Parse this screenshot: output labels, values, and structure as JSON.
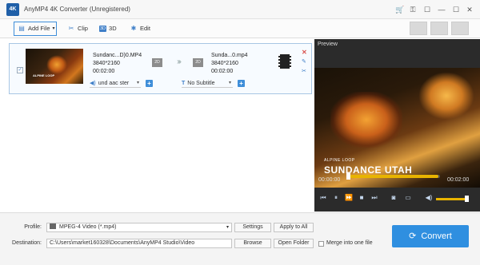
{
  "app": {
    "logo_text": "4K",
    "title": "AnyMP4 4K Converter (Unregistered)"
  },
  "window_controls": {
    "cart": "🛒",
    "key": "⚿",
    "feedback": "☐",
    "minimize": "—",
    "maximize": "☐",
    "close": "✕"
  },
  "toolbar": {
    "add_file": "Add File",
    "clip": "Clip",
    "three_d": "3D",
    "three_d_badge": "3D",
    "edit": "Edit",
    "output_buttons": [
      "",
      "",
      ""
    ]
  },
  "file": {
    "checked": true,
    "check_mark": "✓",
    "thumb_label": "ALPINE LOOP",
    "source": {
      "name": "Sundanc...D)0.MP4",
      "resolution": "3840*2160",
      "duration": "00:02:00"
    },
    "dest": {
      "name": "Sunda...0.mp4",
      "resolution": "3840*2160",
      "duration": "00:02:00"
    },
    "res_badge": "2D",
    "arrows": "›››",
    "audio_track": "und aac ster",
    "subtitle": "No Subtitle",
    "close_icon": "✕",
    "edit_icon": "✎",
    "cut_icon": "✂"
  },
  "preview": {
    "title": "Preview",
    "overlay_small": "ALPINE LOOP",
    "overlay_big": "SUNDANCE UTAH",
    "time_current": "00:00:00",
    "time_total": "00:02:00",
    "progress": 0.98,
    "volume": 0.9
  },
  "bottom": {
    "profile_label": "Profile:",
    "profile_value": "MPEG-4 Video (*.mp4)",
    "settings": "Settings",
    "apply_all": "Apply to All",
    "destination_label": "Destination:",
    "destination_value": "C:\\Users\\market160328\\Documents\\AnyMP4 Studio\\Video",
    "browse": "Browse",
    "open_folder": "Open Folder",
    "merge": "Merge into one file",
    "convert": "Convert"
  }
}
